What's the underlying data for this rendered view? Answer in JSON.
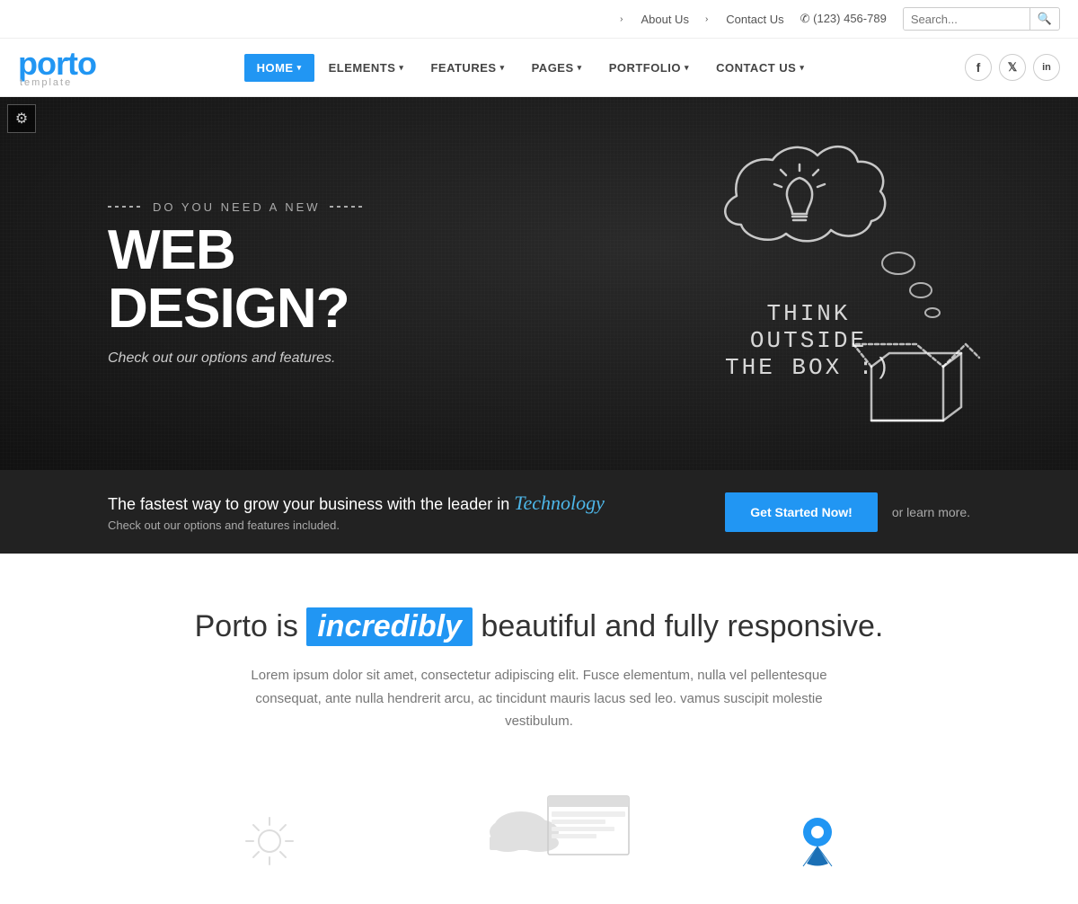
{
  "topbar": {
    "about_label": "About Us",
    "contact_label": "Contact Us",
    "phone": "(123) 456-789",
    "search_placeholder": "Search...",
    "phone_icon": "☎"
  },
  "header": {
    "logo_text": "porto",
    "logo_sub": "template",
    "nav": [
      {
        "label": "HOME",
        "active": true,
        "has_dropdown": true
      },
      {
        "label": "ELEMENTS",
        "active": false,
        "has_dropdown": true
      },
      {
        "label": "FEATURES",
        "active": false,
        "has_dropdown": true
      },
      {
        "label": "PAGES",
        "active": false,
        "has_dropdown": true
      },
      {
        "label": "PORTFOLIO",
        "active": false,
        "has_dropdown": true
      },
      {
        "label": "CONTACT US",
        "active": false,
        "has_dropdown": true
      }
    ],
    "social": [
      {
        "name": "facebook",
        "icon": "f"
      },
      {
        "name": "twitter",
        "icon": "t"
      },
      {
        "name": "linkedin",
        "icon": "in"
      }
    ]
  },
  "hero": {
    "pre_title": "DO YOU NEED A NEW",
    "title": "WEB DESIGN?",
    "subtitle": "Check out our options and features.",
    "chalk_text_line1": "THINK",
    "chalk_text_line2": "OUTSIDE",
    "chalk_text_line3": "THE BOX :)",
    "settings_icon": "⚙"
  },
  "cta": {
    "main_text_before": "The fastest way to grow your business with the leader in",
    "tech_word": "Technology",
    "sub_text": "Check out our options and features included.",
    "button_label": "Get Started Now!",
    "learn_text": "or learn more."
  },
  "content": {
    "headline_before": "Porto is",
    "headline_highlight": "incredibly",
    "headline_after": "beautiful and fully responsive.",
    "body_text": "Lorem ipsum dolor sit amet, consectetur adipiscing elit. Fusce elementum, nulla vel pellentesque consequat, ante nulla hendrerit arcu, ac tincidunt mauris lacus sed leo. vamus suscipit molestie vestibulum."
  },
  "colors": {
    "brand_blue": "#2196f3",
    "hero_bg": "#1a1a1a",
    "cta_bg": "#222"
  }
}
